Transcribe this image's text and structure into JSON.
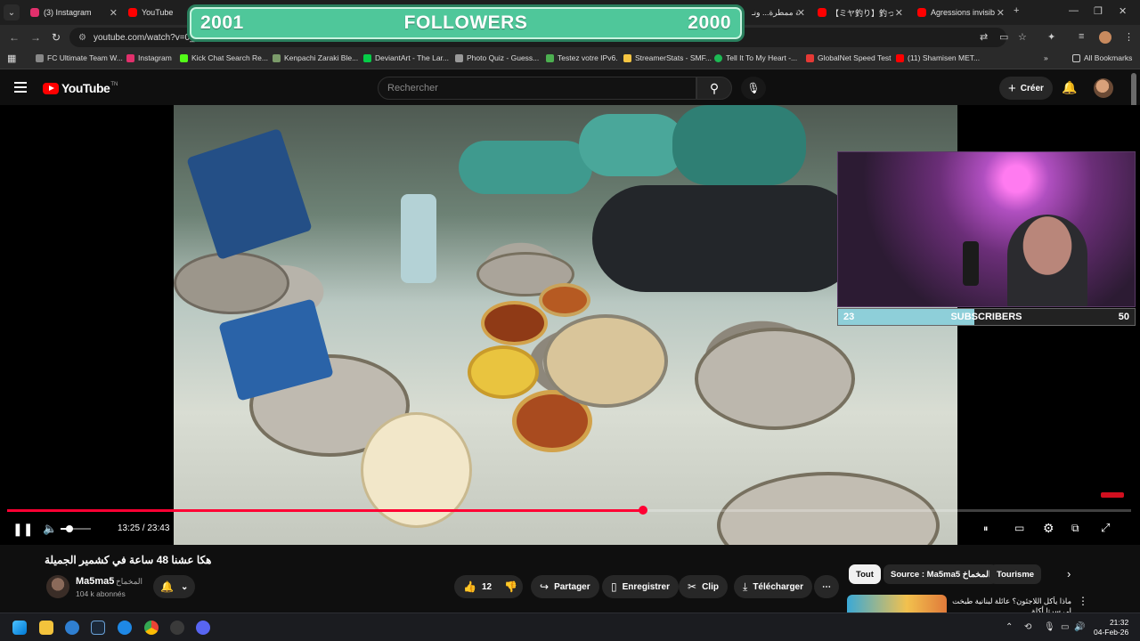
{
  "browser": {
    "tabs": [
      {
        "title": "(3) Instagram",
        "color": "#e1306c"
      },
      {
        "title": "YouTube",
        "color": "#ff0000"
      },
      {
        "title": "ليلة ممطرة... ونـ",
        "color": "#ff0000"
      },
      {
        "title": "【ミヤ釣り】釣った…",
        "color": "#ff0000"
      },
      {
        "title": "Agressions invisib",
        "color": "#ff0000"
      }
    ],
    "url": "youtube.com/watch?v=0_d",
    "bookmarks": [
      {
        "label": "FC Ultimate Team W...",
        "color": "#888888"
      },
      {
        "label": "Instagram",
        "color": "#e1306c"
      },
      {
        "label": "Kick Chat Search Re...",
        "color": "#53fc18"
      },
      {
        "label": "Kenpachi Zaraki Ble...",
        "color": "#7b9b6a"
      },
      {
        "label": "DeviantArt - The Lar...",
        "color": "#05cc47"
      },
      {
        "label": "Photo Quiz - Guess...",
        "color": "#999999"
      },
      {
        "label": "Testez votre IPv6.",
        "color": "#4caf50"
      },
      {
        "label": "StreamerStats - SMF...",
        "color": "#f5c542"
      },
      {
        "label": "Tell It To My Heart -...",
        "color": "#1db954"
      },
      {
        "label": "GlobalNet Speed Test",
        "color": "#e53935"
      },
      {
        "label": "(11) Shamisen MET...",
        "color": "#ff0000"
      }
    ],
    "all_bookmarks": "All Bookmarks"
  },
  "overlay_followers": {
    "left": "2001",
    "label": "FOLLOWERS",
    "right": "2000"
  },
  "overlay_subscribers": {
    "current": "23",
    "label": "SUBSCRIBERS",
    "goal": "50",
    "progress": 0.46
  },
  "youtube": {
    "logo_text": "YouTube",
    "logo_tm": "TN",
    "search_placeholder": "Rechercher",
    "create_label": "Créer",
    "player": {
      "time": "13:25 / 23:43",
      "progress": 0.566,
      "volume": 0.3
    },
    "video_title": "هكا عشنا 48 ساعة في كشمير الجميلة",
    "channel": {
      "name": "Ma5ma5",
      "name_ar": "المخماخ",
      "subscribers": "104 k abonnés"
    },
    "actions": {
      "likes": "12",
      "share": "Partager",
      "save": "Enregistrer",
      "clip": "Clip",
      "download": "Télécharger"
    },
    "chips": [
      "Tout",
      "Source : Ma5ma5 المخماخ",
      "Tourisme"
    ],
    "recommendation_title": "ماذا يأكل اللاجئون؟ عائلة لبنانية طبخت لي سرتا أكلة"
  },
  "taskbar": {
    "time": "21:32",
    "date": "04-Feb-26"
  }
}
